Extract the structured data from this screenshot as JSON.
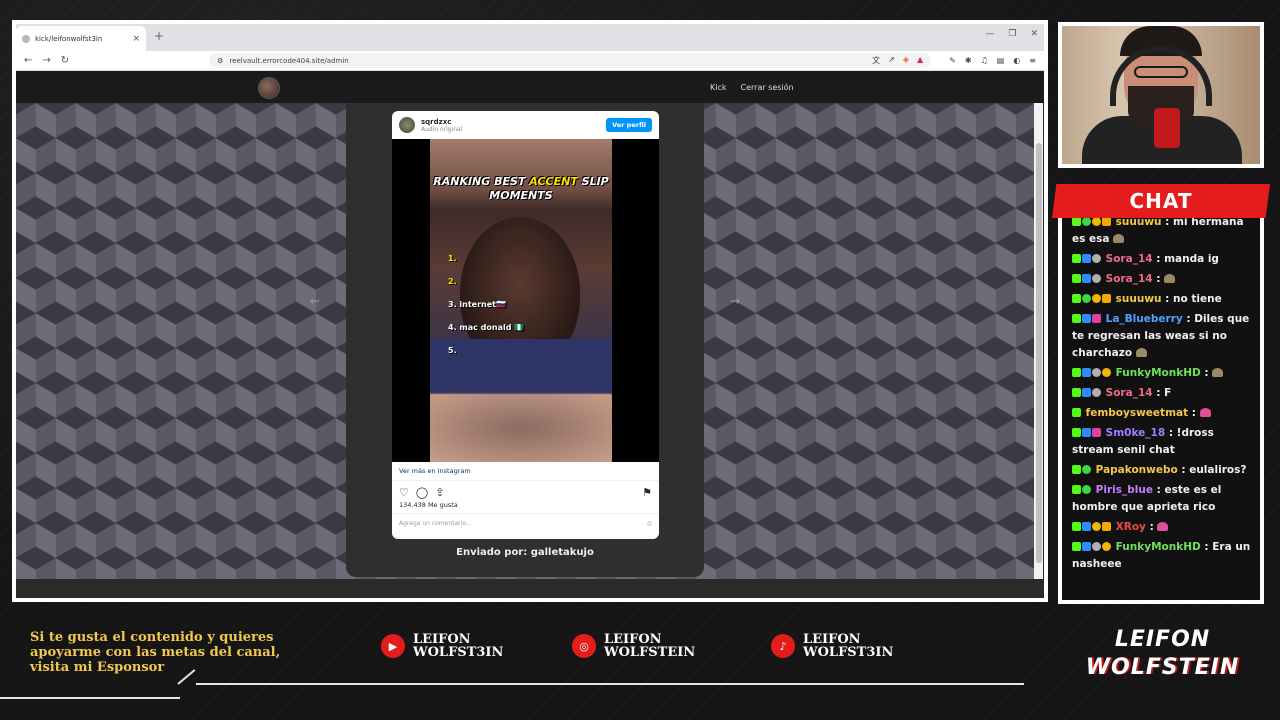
{
  "browser": {
    "tab_title": "kick/leifonwolfst3in",
    "tab_close": "×",
    "new_tab": "+",
    "win_controls": [
      "—",
      "❐",
      "✕"
    ],
    "url": "reelvault.errorcode404.site/admin",
    "nav_back": "←",
    "nav_forward": "→",
    "nav_reload": "↻"
  },
  "site": {
    "nav": [
      "Kick",
      "Cerrar sesión"
    ],
    "arrow_left": "←",
    "arrow_right": "→",
    "sent_by": "Enviado por: galletakujo"
  },
  "instagram": {
    "username": "sqrdzxc",
    "audio": "Audio original",
    "profile_button": "Ver perfil",
    "video_title_1": "RANKING BEST ",
    "video_title_accent": "ACCENT",
    "video_title_2": " SLIP",
    "video_title_3": "MOMENTS",
    "ranks": [
      {
        "num": "1.",
        "label": ""
      },
      {
        "num": "2.",
        "label": ""
      },
      {
        "num": "3.",
        "label": "internet🇷🇺"
      },
      {
        "num": "4.",
        "label": "mac donald 🇳🇬"
      },
      {
        "num": "5.",
        "label": ""
      }
    ],
    "see_more": "Ver más en Instagram",
    "likes": "134.438 Me gusta",
    "comment_placeholder": "Agrega un comentario..."
  },
  "chat": {
    "title": "CHAT",
    "messages": [
      {
        "user": "suuuwu",
        "color": "#f2c94c",
        "text": ": mi hermana es esa"
      },
      {
        "user": "Sora_14",
        "color": "#f06a8a",
        "text": ": manda ig"
      },
      {
        "user": "Sora_14",
        "color": "#f06a8a",
        "text": ":"
      },
      {
        "user": "suuuwu",
        "color": "#f2c94c",
        "text": ": no tiene"
      },
      {
        "user": "La_Blueberry",
        "color": "#4fa3ff",
        "text": ": Diles que te regresan las weas si no charchazo"
      },
      {
        "user": "FunkyMonkHD",
        "color": "#6ee05a",
        "text": ":"
      },
      {
        "user": "Sora_14",
        "color": "#f06a8a",
        "text": ": F"
      },
      {
        "user": "femboysweetmat",
        "color": "#f2c94c",
        "text": ":"
      },
      {
        "user": "Sm0ke_18",
        "color": "#a47cff",
        "text": ": !dross stream senil chat"
      },
      {
        "user": "Papakonwebo",
        "color": "#f2c94c",
        "text": ": eulaliros?"
      },
      {
        "user": "Piris_blue",
        "color": "#c67cff",
        "text": ": este es el hombre que aprieta rico"
      },
      {
        "user": "XRoy",
        "color": "#e84a4a",
        "text": ":"
      },
      {
        "user": "FunkyMonkHD",
        "color": "#6ee05a",
        "text": ": Era un nasheee"
      }
    ]
  },
  "overlay": {
    "support_text": "Si te gusta el contenido y quieres apoyarme con las metas del canal, visita mi Esponsor",
    "youtube_line1": "LEIFON",
    "youtube_line2": "WOLFST3IN",
    "instagram_line1": "LEIFON",
    "instagram_line2": "WOLFSTEIN",
    "tiktok_line1": "LEIFON",
    "tiktok_line2": "WOLFST3IN",
    "brand_line1": "LEIFON",
    "brand_line2": "WOLFSTEIN",
    "youtube_glyph": "▶",
    "instagram_glyph": "◎",
    "tiktok_glyph": "♪"
  },
  "colors": {
    "accent_red": "#e41c1c",
    "accent_yellow": "#f2c94c",
    "kick_green": "#53fc18",
    "ig_blue": "#0095f6"
  }
}
